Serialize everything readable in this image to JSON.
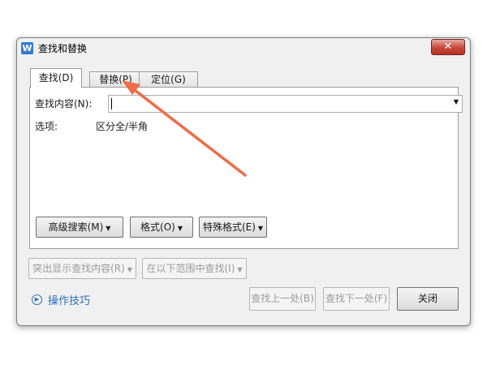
{
  "window": {
    "title": "查找和替换",
    "app_icon_letter": "W",
    "close_symbol": "✕"
  },
  "tabs": [
    {
      "label": "查找(D)",
      "active": true
    },
    {
      "label": "替换(P)",
      "active": false
    },
    {
      "label": "定位(G)",
      "active": false
    }
  ],
  "find": {
    "content_label": "查找内容(N):",
    "content_value": "",
    "options_label": "选项:",
    "options_value": "区分全/半角"
  },
  "panel_buttons": {
    "advanced": "高级搜索(M)",
    "advanced_arrow": "▼",
    "format": "格式(O)",
    "format_arrow": "▼",
    "special": "特殊格式(E)",
    "special_arrow": "▼"
  },
  "lower_buttons": {
    "highlight": "突出显示查找内容(R)",
    "highlight_arrow": "▼",
    "search_in": "在以下范围中查找(I)",
    "search_in_arrow": "▼"
  },
  "footer": {
    "tips": "操作技巧",
    "prev": "查找上一处(B)",
    "next": "查找下一处(F)",
    "close": "关闭"
  },
  "colors": {
    "annotation_arrow": "#f26b45",
    "link": "#2a6ebd",
    "close_button": "#c9473a"
  }
}
